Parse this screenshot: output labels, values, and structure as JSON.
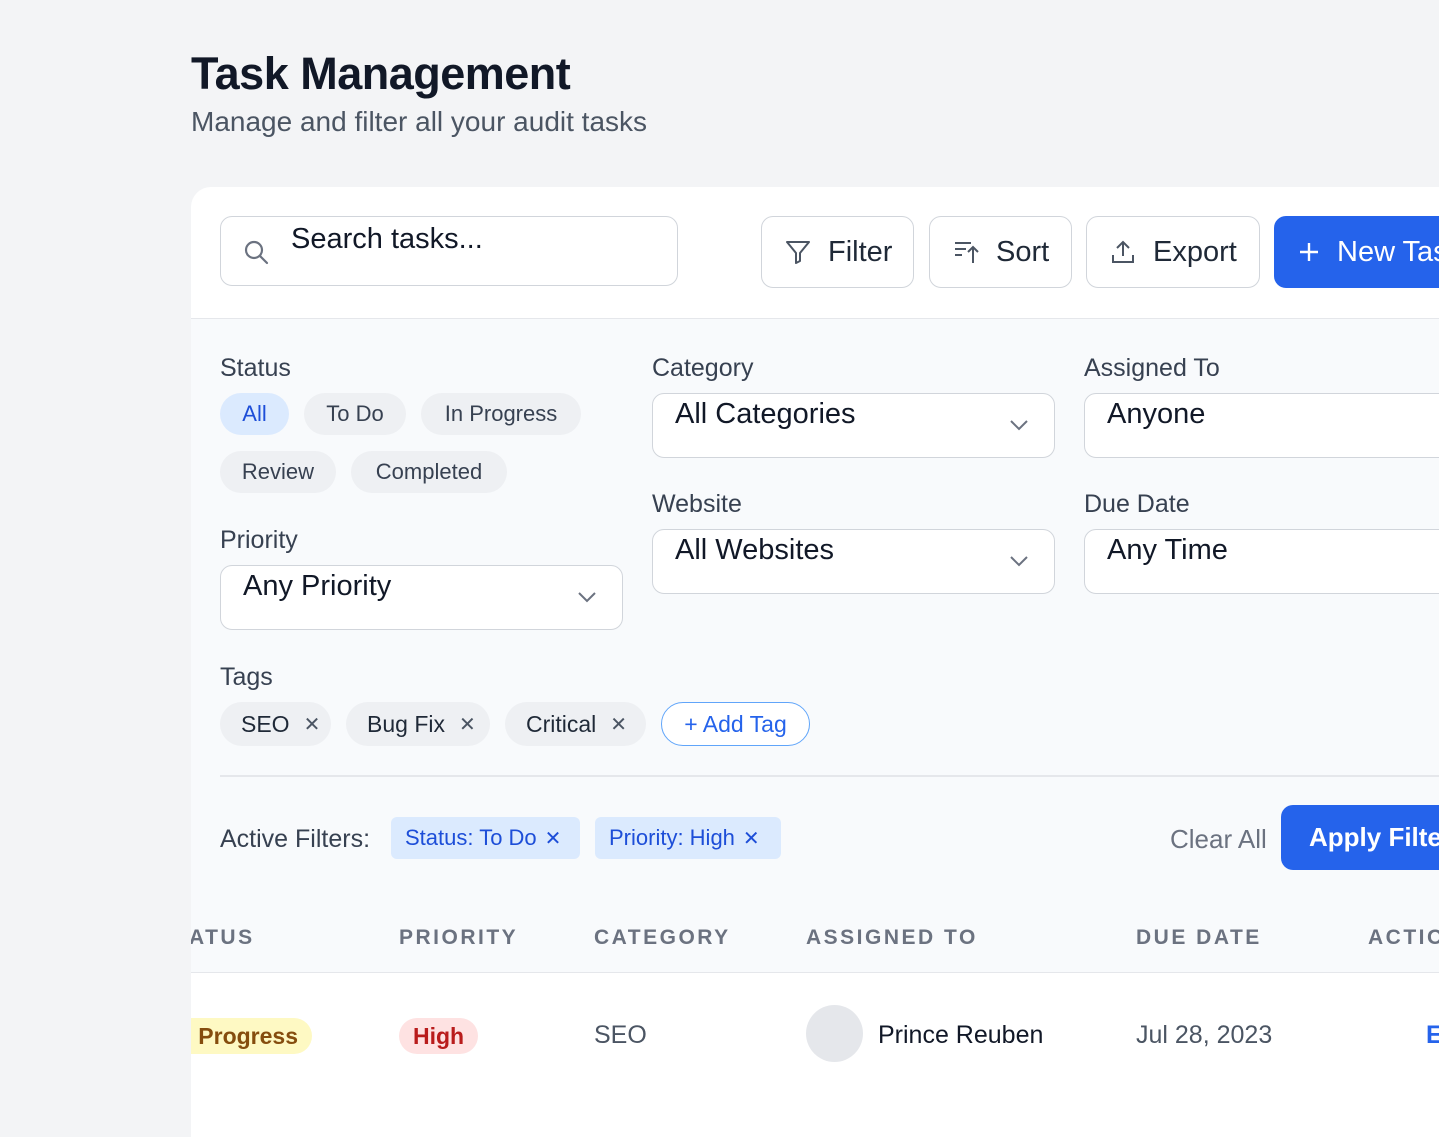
{
  "header": {
    "title": "Task Management",
    "subtitle": "Manage and filter all your audit tasks"
  },
  "toolbar": {
    "search_placeholder": "Search tasks...",
    "filter_label": "Filter",
    "sort_label": "Sort",
    "export_label": "Export",
    "new_task_label": "New Tas"
  },
  "filters": {
    "status": {
      "label": "Status",
      "options": [
        "All",
        "To Do",
        "In Progress",
        "Review",
        "Completed"
      ],
      "selected": "All"
    },
    "category": {
      "label": "Category",
      "value": "All Categories"
    },
    "assigned_to": {
      "label": "Assigned To",
      "value": "Anyone"
    },
    "priority": {
      "label": "Priority",
      "value": "Any Priority"
    },
    "website": {
      "label": "Website",
      "value": "All Websites"
    },
    "due_date": {
      "label": "Due Date",
      "value": "Any Time"
    },
    "tags": {
      "label": "Tags",
      "items": [
        "SEO",
        "Bug Fix",
        "Critical"
      ],
      "add_label": "+ Add Tag"
    },
    "active": {
      "label": "Active Filters:",
      "chips": [
        "Status: To Do",
        "Priority: High"
      ],
      "clear_label": "Clear All",
      "apply_label": "Apply Filter"
    }
  },
  "table": {
    "columns": [
      "ATUS",
      "PRIORITY",
      "CATEGORY",
      "ASSIGNED TO",
      "DUE DATE",
      "ACTIO"
    ],
    "rows": [
      {
        "status": "n Progress",
        "priority": "High",
        "category": "SEO",
        "assignee": "Prince Reuben",
        "due_date": "Jul 28, 2023",
        "action": "E"
      }
    ]
  },
  "colors": {
    "accent": "#2563eb",
    "status_in_progress_bg": "#fef9c3",
    "status_in_progress_fg": "#854d0e",
    "priority_high_bg": "#fee2e2",
    "priority_high_fg": "#b91c1c"
  },
  "icons": {
    "search": "search-icon",
    "filter": "funnel-icon",
    "sort": "sort-icon",
    "export": "upload-icon",
    "new": "plus-icon",
    "dropdown": "chevron-down-icon",
    "remove": "close-icon"
  }
}
